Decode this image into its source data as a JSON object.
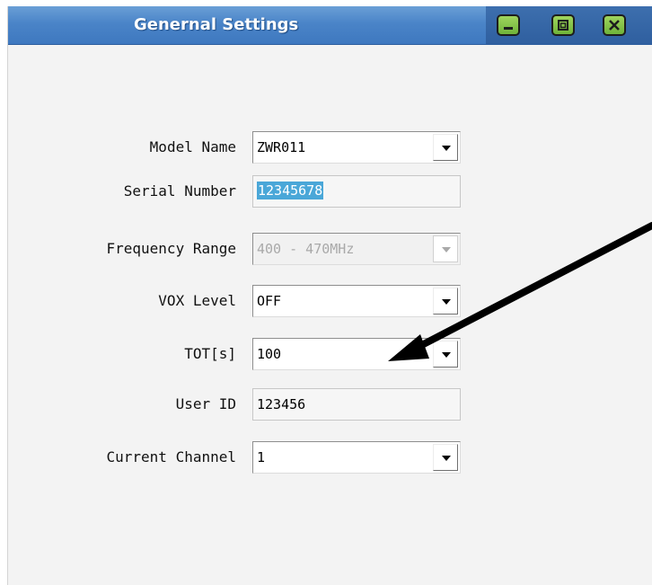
{
  "window": {
    "title": "Genernal Settings",
    "buttons": {
      "minimize": "minimize-icon",
      "maximize": "maximize-icon",
      "close": "close-icon"
    },
    "colors": {
      "titlebar": "#4a84c8",
      "button": "#7fbf45",
      "selection": "#4aa7d8"
    }
  },
  "form": {
    "model_name": {
      "label": "Model Name",
      "value": "ZWR011"
    },
    "serial_number": {
      "label": "Serial Number",
      "value": "12345678"
    },
    "frequency_range": {
      "label": "Frequency Range",
      "value": "400 - 470MHz"
    },
    "vox_level": {
      "label": "VOX Level",
      "value": "OFF"
    },
    "tot": {
      "label": "TOT[s]",
      "value": "100"
    },
    "user_id": {
      "label": "User ID",
      "value": "123456"
    },
    "current_channel": {
      "label": "Current Channel",
      "value": "1"
    }
  }
}
